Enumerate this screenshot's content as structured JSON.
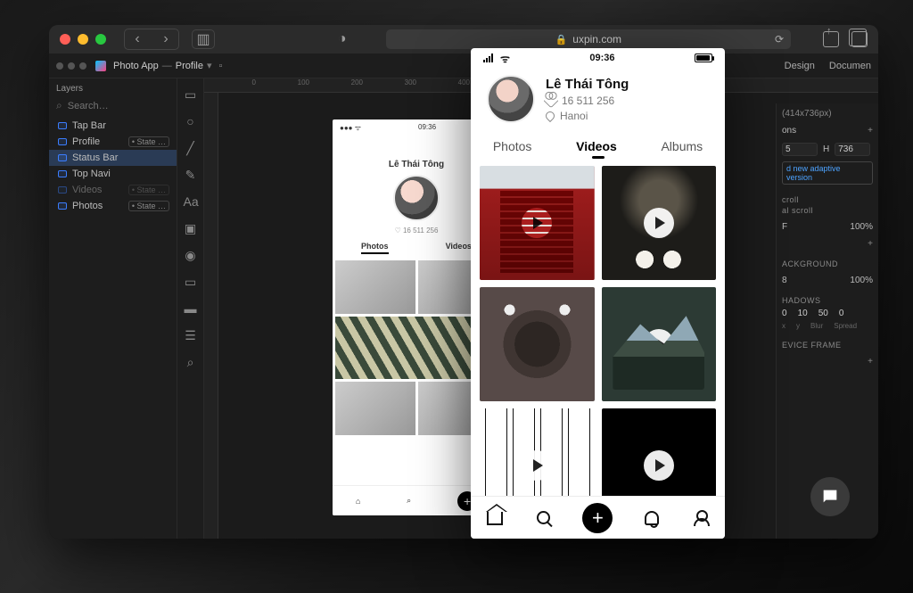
{
  "browser": {
    "address": "uxpin.com",
    "lock_label": "Secure"
  },
  "editor": {
    "project": "Photo App",
    "page": "Profile",
    "top_tabs": [
      "Design",
      "Documen"
    ],
    "viewport_label": "(414x736px)",
    "layers": {
      "title": "Layers",
      "search_placeholder": "Search…",
      "items": [
        {
          "name": "Tap Bar",
          "state": "",
          "dim": false
        },
        {
          "name": "Profile",
          "state": "• State …",
          "dim": false
        },
        {
          "name": "Status Bar",
          "state": "",
          "selected": true
        },
        {
          "name": "Top Navi",
          "state": "",
          "dim": false
        },
        {
          "name": "Videos",
          "state": "• State …",
          "dim": true
        },
        {
          "name": "Photos",
          "state": "• State …",
          "dim": false
        }
      ]
    },
    "ruler_marks": [
      "0",
      "100",
      "200",
      "300",
      "400"
    ],
    "props": {
      "dimensions_hint": "ons",
      "width": "5",
      "height_label": "H",
      "height": "736",
      "adaptive_btn": "d new adaptive version",
      "scroll1": "croll",
      "scroll2": "al scroll",
      "fill_label": "F",
      "fill_pct": "100%",
      "bg_label": "ACKGROUND",
      "bg_opacity_a": "8",
      "bg_opacity_b": "100%",
      "shadows_label": "HADOWS",
      "shadow_vals": [
        "0",
        "10",
        "50",
        "0"
      ],
      "shadow_sub": [
        "x",
        "y",
        "Blur",
        "Spread"
      ],
      "device_label": "EVICE FRAME"
    }
  },
  "artboard_small": {
    "time": "09:36",
    "name": "Lê Thái Tông",
    "likes": "16 511 256",
    "tabs": [
      "Photos",
      "Videos"
    ]
  },
  "phone": {
    "time": "09:36",
    "name": "Lê Thái Tông",
    "likes": "16 511 256",
    "location": "Hanoi",
    "tabs": {
      "photos": "Photos",
      "videos": "Videos",
      "albums": "Albums"
    }
  }
}
